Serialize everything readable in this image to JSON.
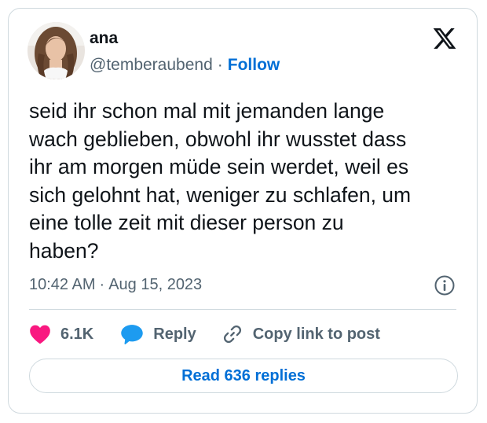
{
  "author": {
    "display_name": "ana",
    "handle": "@temberaubend",
    "separator": "·",
    "follow_label": "Follow"
  },
  "brand": {
    "logo_icon": "x-logo-icon"
  },
  "tweet": {
    "text": "seid ihr schon mal mit jemanden lange\nwach geblieben, obwohl ihr wusstet dass\nihr am morgen müde sein werdet, weil es\nsich gelohnt hat, weniger zu schlafen, um\neine tolle zeit mit dieser person zu\nhaben?",
    "time": "10:42 AM",
    "separator": "·",
    "date": "Aug 15, 2023"
  },
  "actions": {
    "likes_count": "6.1K",
    "reply_label": "Reply",
    "copy_label": "Copy link to post"
  },
  "footer": {
    "read_replies_label": "Read 636 replies"
  },
  "colors": {
    "accent": "#006fd6",
    "like": "#f91880",
    "reply_bubble": "#1d9bf0",
    "secondary_text": "#536471",
    "border": "#cfd9de"
  }
}
